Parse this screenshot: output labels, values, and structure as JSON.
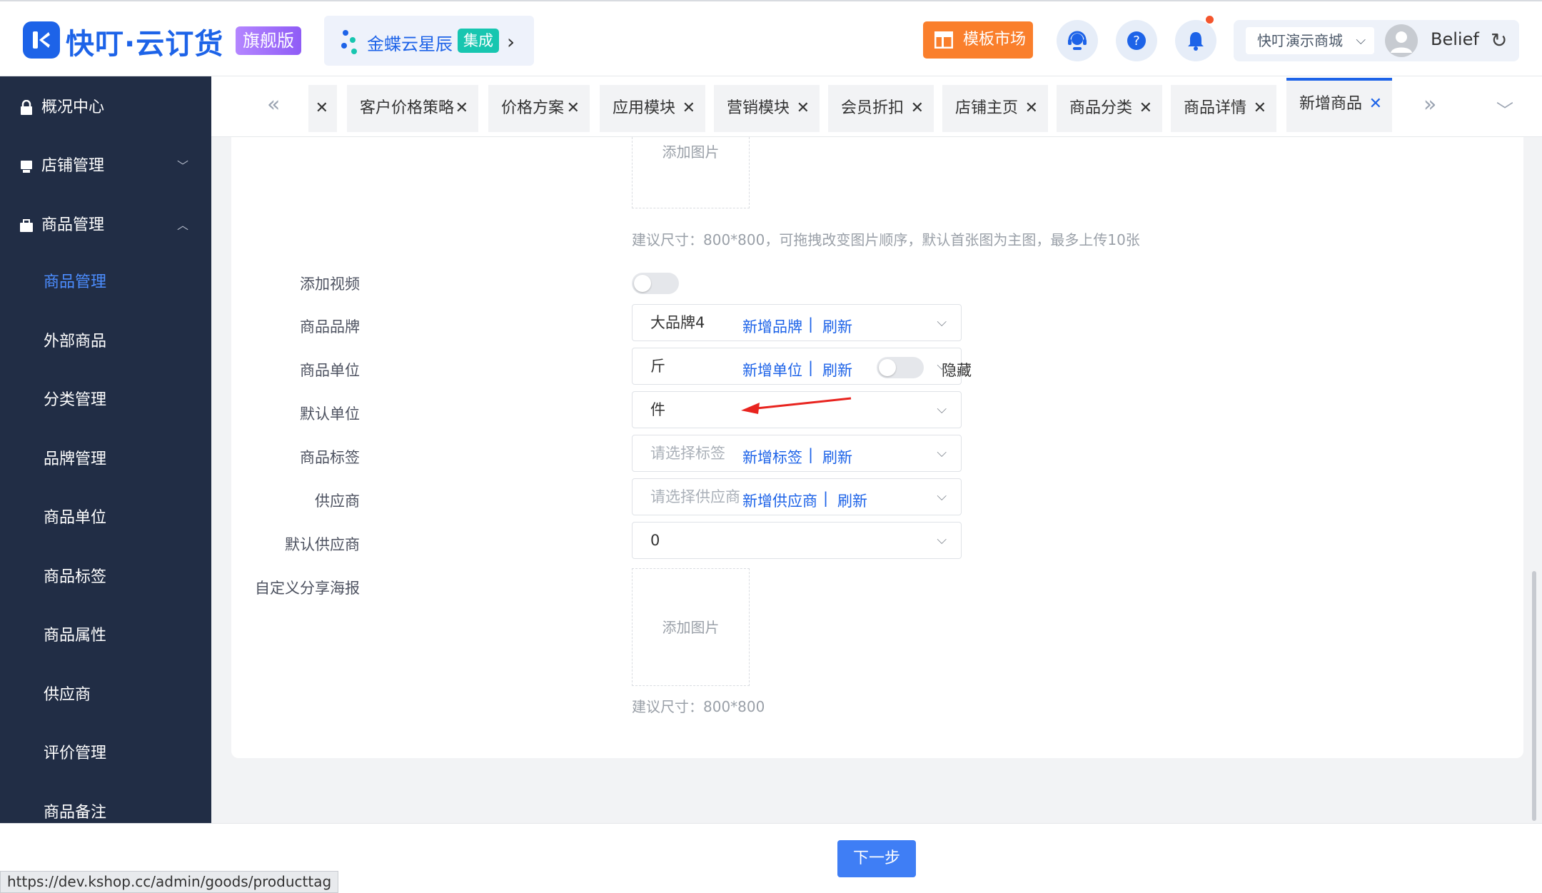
{
  "header": {
    "logo_text": "快叮·云订货",
    "edition_badge": "旗舰版",
    "integration_name": "金蝶云星辰",
    "integration_badge": "集成",
    "template_market": "模板市场",
    "store_name": "快叮演示商城",
    "user_name": "Belief"
  },
  "sidebar": {
    "groups": [
      {
        "label": "概况中心",
        "icon": "lock-icon"
      },
      {
        "label": "店铺管理",
        "icon": "store-icon"
      },
      {
        "label": "商品管理",
        "icon": "briefcase-icon"
      }
    ],
    "items": [
      {
        "label": "商品管理",
        "active": true
      },
      {
        "label": "外部商品"
      },
      {
        "label": "分类管理"
      },
      {
        "label": "品牌管理"
      },
      {
        "label": "商品单位"
      },
      {
        "label": "商品标签"
      },
      {
        "label": "商品属性"
      },
      {
        "label": "供应商"
      },
      {
        "label": "评价管理"
      },
      {
        "label": "商品备注"
      }
    ]
  },
  "tabs": [
    {
      "label": "客户价格策略"
    },
    {
      "label": "价格方案"
    },
    {
      "label": "应用模块"
    },
    {
      "label": "营销模块"
    },
    {
      "label": "会员折扣"
    },
    {
      "label": "店铺主页"
    },
    {
      "label": "商品分类"
    },
    {
      "label": "商品详情"
    },
    {
      "label": "新增商品",
      "active": true
    }
  ],
  "form": {
    "upload_label": "添加图片",
    "image_hint": "建议尺寸：800*800，可拖拽改变图片顺序，默认首张图为主图，最多上传10张",
    "add_video_label": "添加视频",
    "brand": {
      "label": "商品品牌",
      "value": "大品牌4",
      "add_link": "新增品牌",
      "refresh": "刷新"
    },
    "unit": {
      "label": "商品单位",
      "value": "斤",
      "add_link": "新增单位",
      "refresh": "刷新",
      "hide_label": "隐藏"
    },
    "default_unit": {
      "label": "默认单位",
      "value": "件"
    },
    "tag": {
      "label": "商品标签",
      "placeholder": "请选择标签",
      "add_link": "新增标签",
      "refresh": "刷新"
    },
    "supplier": {
      "label": "供应商",
      "placeholder": "请选择供应商",
      "add_link": "新增供应商",
      "refresh": "刷新"
    },
    "default_supplier": {
      "label": "默认供应商",
      "value": "0"
    },
    "poster": {
      "label": "自定义分享海报",
      "upload_label": "添加图片",
      "hint": "建议尺寸：800*800"
    },
    "separator": "|"
  },
  "footer": {
    "next_button": "下一步",
    "status_url": "https://dev.kshop.cc/admin/goods/producttag"
  },
  "colors": {
    "brand_blue": "#1d63e8",
    "sidebar_bg": "#212d45",
    "template_orange": "#fa7f2c",
    "annotation_red": "#e8241f"
  }
}
